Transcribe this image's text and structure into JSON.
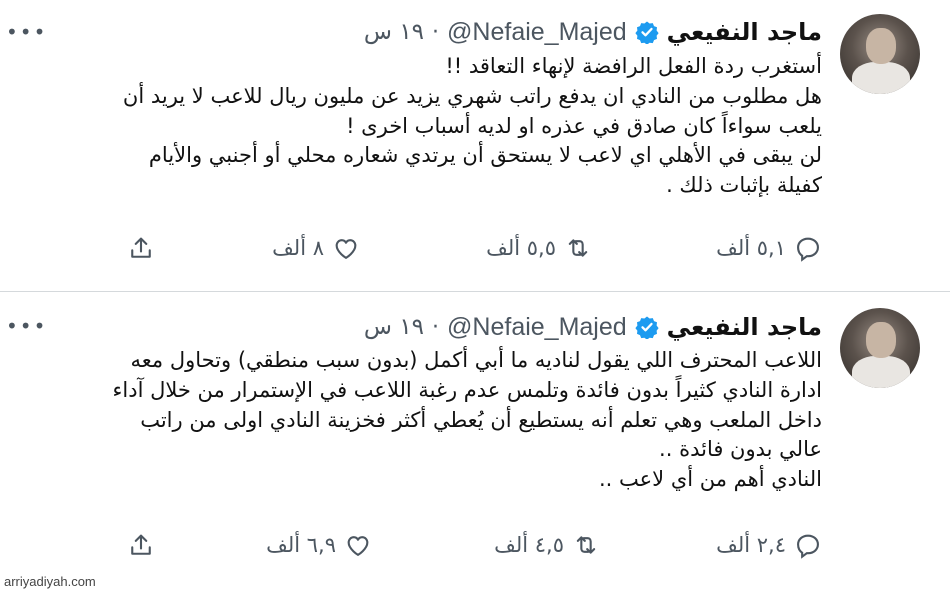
{
  "tweets": [
    {
      "author_name": "ماجد النفيعي",
      "handle": "@Nefaie_Majed",
      "separator": "·",
      "time": "١٩ س",
      "lines": [
        "أستغرب ردة الفعل الرافضة لإنهاء التعاقد !!",
        "هل مطلوب من النادي ان يدفع راتب شهري يزيد عن مليون ريال للاعب لا يريد أن",
        "يلعب سواءاً كان صادق في عذره او لديه أسباب اخرى !",
        "لن يبقى في الأهلي اي لاعب لا يستحق أن يرتدي شعاره محلي أو أجنبي والأيام",
        "كفيلة بإثبات ذلك ."
      ],
      "replies": "٥,١ ألف",
      "retweets": "٥,٥ ألف",
      "likes": "٨ ألف"
    },
    {
      "author_name": "ماجد النفيعي",
      "handle": "@Nefaie_Majed",
      "separator": "·",
      "time": "١٩ س",
      "lines": [
        "اللاعب المحترف اللي يقول لناديه ما أبي أكمل (بدون سبب منطقي) وتحاول معه",
        "ادارة النادي كثيراً بدون فائدة وتلمس عدم رغبة اللاعب في الإستمرار من خلال آداء",
        "داخل الملعب وهي تعلم أنه يستطيع أن يُعطي أكثر فخزينة النادي اولى من راتب",
        "عالي بدون فائدة ..",
        "النادي أهم من أي لاعب .."
      ],
      "replies": "٢,٤ ألف",
      "retweets": "٤,٥ ألف",
      "likes": "٦,٩ ألف"
    }
  ],
  "watermark": "arriyadiyah.com",
  "colors": {
    "verified": "#1d9bf0",
    "muted": "#4c5660",
    "divider": "#d5d9dc"
  },
  "icons": [
    "more-icon",
    "verified-icon",
    "reply-icon",
    "retweet-icon",
    "like-icon",
    "share-icon"
  ]
}
